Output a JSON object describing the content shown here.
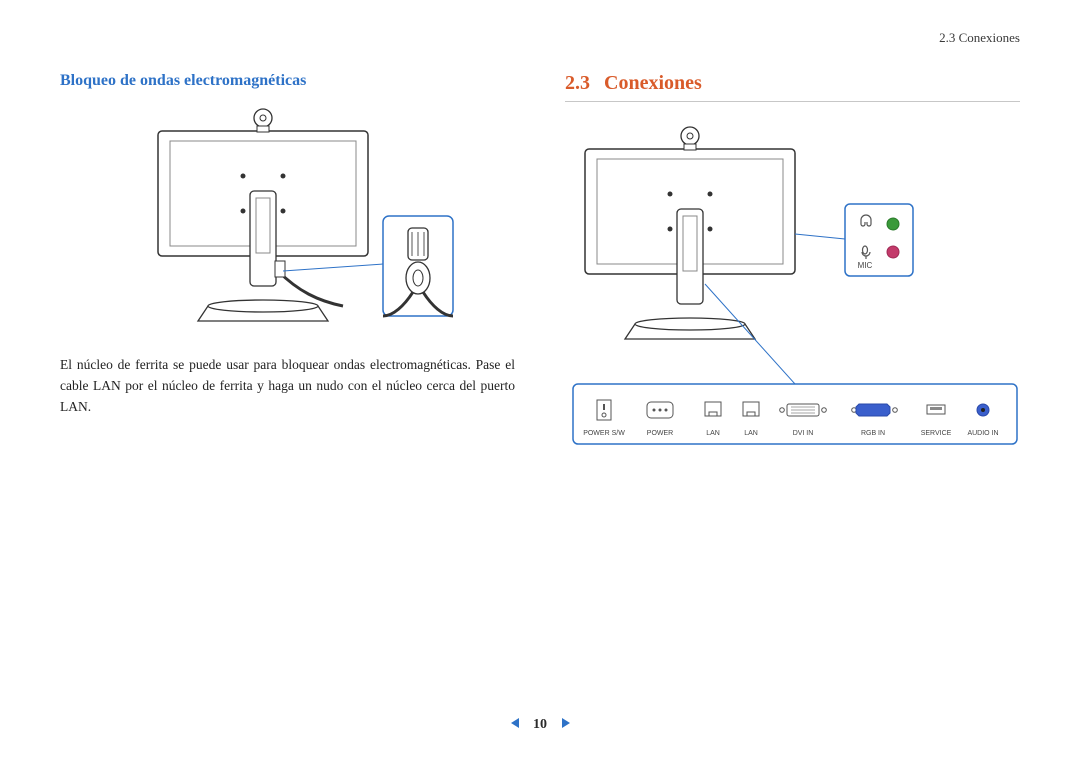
{
  "runningHead": "2.3 Conexiones",
  "left": {
    "subheading": "Bloqueo de ondas electromagnéticas",
    "paragraph": "El núcleo de ferrita se puede usar para bloquear ondas electromagnéticas. Pase el cable LAN por el núcleo de ferrita y haga un nudo con el núcleo cerca del puerto LAN."
  },
  "right": {
    "sectionNumber": "2.3",
    "sectionTitle": "Conexiones",
    "sideCallout": {
      "micLabel": "MIC"
    },
    "ports": {
      "items": [
        {
          "label": "POWER S/W"
        },
        {
          "label": "POWER"
        },
        {
          "label": "LAN"
        },
        {
          "label": "LAN"
        },
        {
          "label": "DVI IN"
        },
        {
          "label": "RGB IN"
        },
        {
          "label": "SERVICE"
        },
        {
          "label": "AUDIO IN"
        }
      ]
    }
  },
  "pageNumber": "10"
}
